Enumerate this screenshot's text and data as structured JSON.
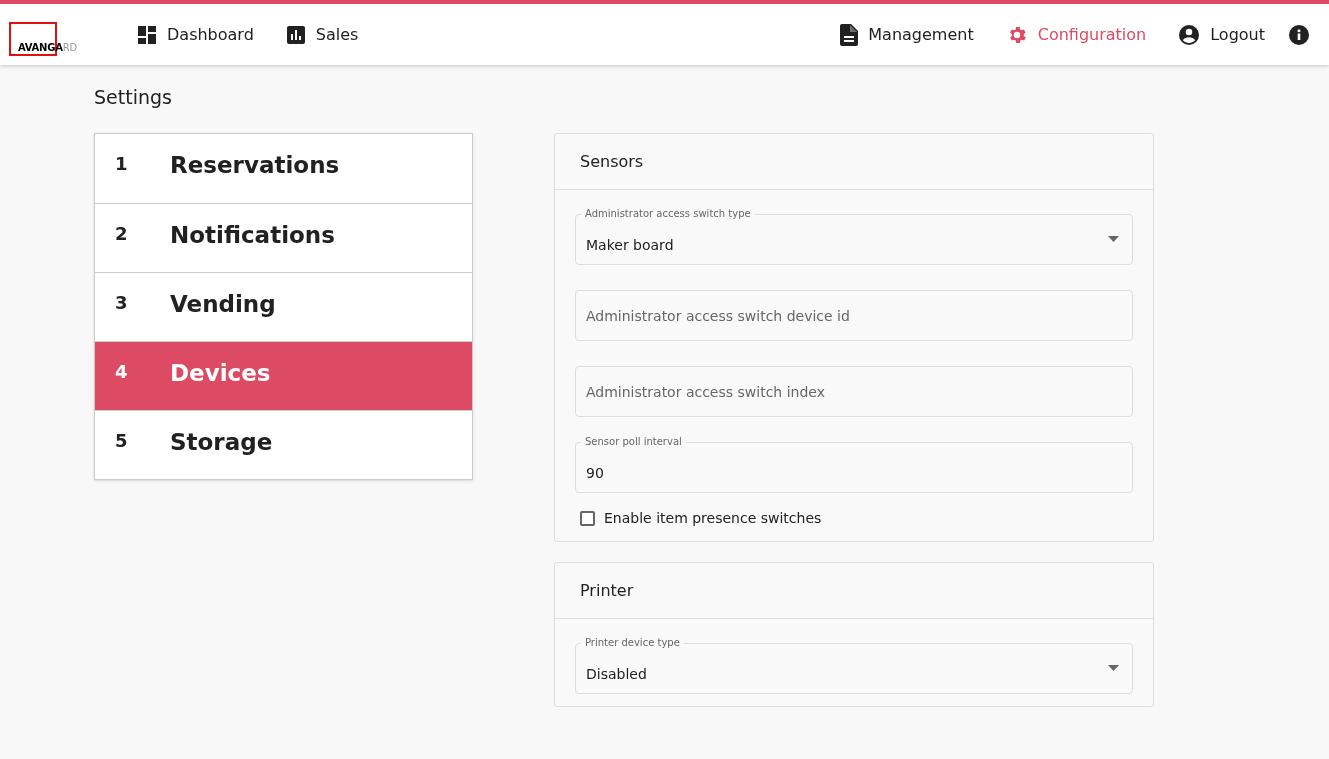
{
  "logo": {
    "dark": "AVANGA",
    "light": "RD"
  },
  "nav_left": [
    {
      "label": "Dashboard",
      "selected": false
    },
    {
      "label": "Sales",
      "selected": false
    }
  ],
  "nav_right": [
    {
      "label": "Management",
      "selected": false
    },
    {
      "label": "Configuration",
      "selected": true
    },
    {
      "label": "Logout",
      "selected": false
    }
  ],
  "page_title": "Settings",
  "steps": [
    {
      "number": "1",
      "label": "Reservations",
      "selected": false
    },
    {
      "number": "2",
      "label": "Notifications",
      "selected": false
    },
    {
      "number": "3",
      "label": "Vending",
      "selected": false
    },
    {
      "number": "4",
      "label": "Devices",
      "selected": true
    },
    {
      "number": "5",
      "label": "Storage",
      "selected": false
    }
  ],
  "sections": [
    {
      "title": "Sensors",
      "fields": [
        {
          "kind": "select",
          "label": "Administrator access switch type",
          "value": "Maker board"
        },
        {
          "kind": "text",
          "placeholder": "Administrator access switch device id"
        },
        {
          "kind": "text",
          "placeholder": "Administrator access switch index"
        },
        {
          "kind": "text",
          "label": "Sensor poll interval",
          "value": "90"
        },
        {
          "kind": "checkbox",
          "label": "Enable item presence switches",
          "checked": false
        }
      ]
    },
    {
      "title": "Printer",
      "fields": [
        {
          "kind": "select",
          "label": "Printer device type",
          "value": "Disabled"
        }
      ]
    }
  ]
}
